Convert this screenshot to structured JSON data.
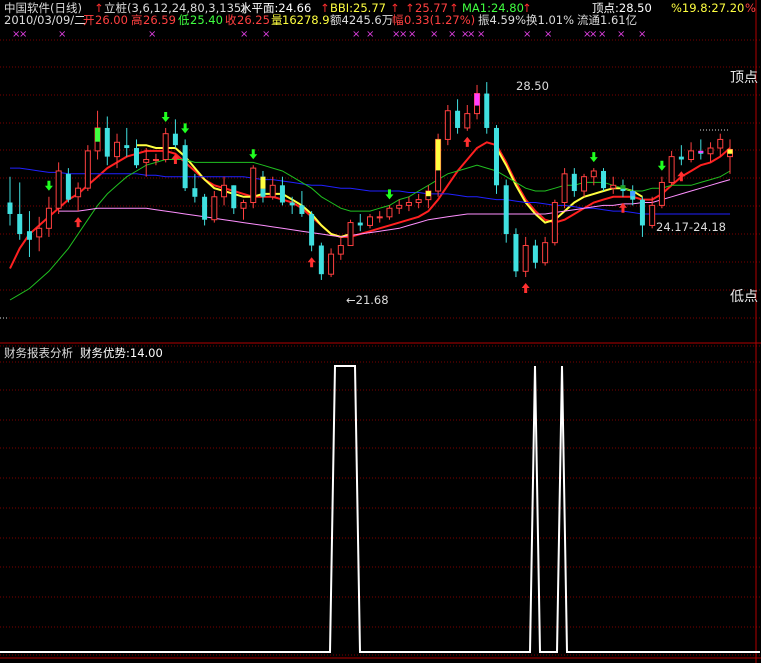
{
  "header": {
    "title": "中国软件(日线)",
    "indicator": "立桩(3,6,12,24,80,3,135)",
    "level": "水平面:24.66",
    "bbi": "BBI:25.77",
    "bbi_value": "25.77",
    "ma1": "MA1:24.80",
    "peak": "顶点:28.50",
    "ratio": "%19.8:27.20",
    "pct": "%"
  },
  "quote": {
    "date": "2010/03/09/二",
    "open_label": "开",
    "open": "26.00",
    "high_label": "高",
    "high": "26.59",
    "low_label": "低",
    "low": "25.40",
    "close_label": "收",
    "close": "26.25",
    "volume_label": "量",
    "volume": "16278.9",
    "amount": "额4245.6万",
    "change_label": "幅",
    "change": "0.33(1.27%)",
    "amplitude": "振4.59%",
    "turnover": "换1.01%",
    "float": "流通1.61亿"
  },
  "annotations": {
    "top_label": "顶点",
    "bottom_label": "低点",
    "high_price": "28.50",
    "low_price": "←21.68",
    "range": "24.17-24.18"
  },
  "lower_panel": {
    "title": "财务报表分析",
    "indicator": "财务优势:14.00"
  },
  "chart_data": {
    "type": "candlestick",
    "panels": [
      {
        "name": "price",
        "ylim": [
          21.0,
          29.3
        ],
        "annotated_values": {
          "high": 28.5,
          "low": 21.68
        },
        "candles": [
          [
            24.4,
            25.3,
            23.6,
            24.0
          ],
          [
            24.0,
            25.1,
            23.1,
            23.3
          ],
          [
            23.4,
            24.1,
            22.5,
            23.1
          ],
          [
            23.2,
            23.9,
            22.7,
            23.5
          ],
          [
            23.5,
            24.6,
            23.2,
            24.2
          ],
          [
            24.2,
            25.8,
            24.0,
            25.5
          ],
          [
            25.4,
            25.6,
            24.4,
            24.5
          ],
          [
            24.6,
            25.1,
            24.1,
            24.9
          ],
          [
            24.9,
            26.4,
            24.8,
            26.2
          ],
          [
            26.2,
            27.6,
            25.9,
            27.0
          ],
          [
            27.0,
            27.4,
            25.7,
            26.0
          ],
          [
            26.0,
            26.8,
            25.6,
            26.5
          ],
          [
            26.4,
            27.0,
            26.0,
            26.3
          ],
          [
            26.3,
            26.6,
            25.6,
            25.7
          ],
          [
            25.8,
            26.3,
            25.3,
            25.9
          ],
          [
            25.9,
            26.1,
            25.7,
            25.9
          ],
          [
            25.9,
            27.0,
            25.8,
            26.8
          ],
          [
            26.8,
            27.3,
            26.3,
            26.4
          ],
          [
            26.4,
            26.6,
            24.8,
            24.9
          ],
          [
            24.9,
            25.4,
            24.4,
            24.6
          ],
          [
            24.6,
            24.7,
            23.6,
            23.8
          ],
          [
            23.8,
            24.8,
            23.7,
            24.6
          ],
          [
            24.6,
            25.3,
            24.3,
            25.0
          ],
          [
            25.0,
            25.0,
            24.0,
            24.2
          ],
          [
            24.2,
            24.5,
            23.8,
            24.4
          ],
          [
            24.4,
            25.7,
            24.2,
            25.6
          ],
          [
            25.3,
            25.5,
            24.4,
            24.6
          ],
          [
            24.6,
            25.3,
            24.5,
            25.0
          ],
          [
            25.0,
            25.3,
            24.3,
            24.4
          ],
          [
            24.4,
            24.6,
            24.0,
            24.3
          ],
          [
            24.3,
            24.8,
            23.9,
            24.0
          ],
          [
            24.0,
            24.1,
            22.7,
            22.9
          ],
          [
            22.9,
            23.0,
            21.7,
            21.9
          ],
          [
            21.9,
            22.8,
            21.8,
            22.6
          ],
          [
            22.6,
            23.2,
            22.4,
            22.9
          ],
          [
            22.9,
            23.8,
            22.9,
            23.7
          ],
          [
            23.7,
            24.0,
            23.4,
            23.6
          ],
          [
            23.6,
            24.0,
            23.5,
            23.9
          ],
          [
            23.9,
            24.1,
            23.7,
            23.9
          ],
          [
            23.9,
            24.3,
            23.8,
            24.2
          ],
          [
            24.2,
            24.5,
            24.0,
            24.3
          ],
          [
            24.3,
            24.6,
            24.1,
            24.4
          ],
          [
            24.4,
            24.7,
            24.2,
            24.5
          ],
          [
            24.5,
            25.0,
            24.2,
            24.8
          ],
          [
            24.8,
            26.8,
            24.6,
            26.6
          ],
          [
            26.6,
            27.8,
            26.4,
            27.6
          ],
          [
            27.6,
            28.0,
            26.8,
            27.0
          ],
          [
            27.0,
            27.8,
            26.9,
            27.5
          ],
          [
            27.5,
            28.5,
            27.3,
            28.2
          ],
          [
            28.2,
            28.6,
            26.8,
            27.0
          ],
          [
            27.0,
            27.1,
            24.7,
            25.0
          ],
          [
            25.0,
            25.2,
            23.0,
            23.3
          ],
          [
            23.3,
            23.5,
            21.8,
            22.0
          ],
          [
            22.0,
            23.2,
            21.8,
            22.9
          ],
          [
            22.9,
            23.1,
            22.1,
            22.3
          ],
          [
            22.3,
            23.2,
            22.2,
            23.0
          ],
          [
            23.0,
            24.5,
            22.9,
            24.4
          ],
          [
            24.4,
            25.6,
            24.2,
            25.4
          ],
          [
            25.4,
            25.6,
            24.6,
            24.8
          ],
          [
            24.8,
            25.4,
            24.6,
            25.3
          ],
          [
            25.3,
            25.6,
            25.0,
            25.5
          ],
          [
            25.5,
            25.6,
            24.8,
            24.9
          ],
          [
            24.9,
            25.3,
            24.7,
            25.0
          ],
          [
            25.0,
            25.2,
            24.6,
            24.8
          ],
          [
            24.8,
            25.0,
            24.3,
            24.5
          ],
          [
            24.5,
            24.6,
            23.2,
            23.6
          ],
          [
            23.6,
            24.6,
            23.5,
            24.3
          ],
          [
            24.3,
            25.3,
            24.2,
            25.1
          ],
          [
            25.1,
            26.2,
            25.0,
            26.0
          ],
          [
            26.0,
            26.4,
            25.7,
            25.9
          ],
          [
            25.9,
            26.5,
            25.8,
            26.2
          ],
          [
            26.2,
            26.6,
            25.9,
            26.1
          ],
          [
            26.1,
            26.5,
            25.8,
            26.3
          ],
          [
            26.3,
            26.8,
            26.0,
            26.6
          ],
          [
            26.0,
            26.6,
            25.4,
            26.25
          ]
        ],
        "series": [
          {
            "name": "BBI",
            "color": "#ff2020",
            "values": [
              22.1,
              22.8,
              23.3,
              23.6,
              23.9,
              24.2,
              24.5,
              24.7,
              25.0,
              25.3,
              25.6,
              25.8,
              26.0,
              26.1,
              26.2,
              26.2,
              26.2,
              26.1,
              25.8,
              25.5,
              25.2,
              25.0,
              24.9,
              24.8,
              24.7,
              24.6,
              24.6,
              24.6,
              24.5,
              24.4,
              24.2,
              23.9,
              23.6,
              23.3,
              23.2,
              23.2,
              23.3,
              23.4,
              23.5,
              23.6,
              23.7,
              23.8,
              23.9,
              24.1,
              24.5,
              25.0,
              25.5,
              25.9,
              26.3,
              26.5,
              26.4,
              25.8,
              25.1,
              24.5,
              24.1,
              23.8,
              23.7,
              23.8,
              24.0,
              24.2,
              24.4,
              24.5,
              24.6,
              24.6,
              24.6,
              24.5,
              24.5,
              24.7,
              25.0,
              25.3,
              25.5,
              25.7,
              25.8,
              26.0,
              26.3
            ]
          },
          {
            "name": "MA1",
            "color": "#ffff40",
            "values": [
              null,
              null,
              null,
              null,
              null,
              null,
              null,
              null,
              null,
              null,
              null,
              null,
              null,
              26.4,
              26.4,
              26.3,
              26.3,
              26.3,
              26.0,
              25.6,
              25.2,
              24.9,
              24.8,
              24.7,
              24.6,
              24.6,
              24.7,
              24.7,
              24.7,
              24.5,
              24.3,
              24.0,
              23.6,
              23.3,
              23.2,
              23.3,
              null,
              null,
              null,
              null,
              null,
              null,
              null,
              null,
              null,
              null,
              null,
              null,
              null,
              null,
              26.3,
              25.7,
              25.0,
              24.4,
              24.0,
              23.7,
              23.8,
              24.1,
              24.4,
              24.6,
              24.7,
              24.8,
              24.9,
              24.9,
              24.8,
              24.6,
              null,
              null,
              null,
              null,
              null,
              null,
              null,
              null,
              null
            ]
          },
          {
            "name": "line3",
            "color": "#2020ff",
            "values": [
              25.6,
              25.6,
              25.55,
              25.5,
              25.45,
              25.45,
              25.4,
              25.4,
              25.4,
              25.4,
              25.4,
              25.4,
              25.4,
              25.4,
              25.35,
              25.35,
              25.3,
              25.3,
              25.3,
              25.3,
              25.3,
              25.3,
              25.3,
              25.3,
              25.3,
              25.25,
              25.2,
              25.2,
              25.15,
              25.1,
              25.05,
              25.0,
              25.0,
              24.95,
              24.9,
              24.9,
              24.85,
              24.8,
              24.8,
              24.8,
              24.8,
              24.75,
              24.75,
              24.7,
              24.7,
              24.7,
              24.65,
              24.6,
              24.6,
              24.55,
              24.5,
              24.5,
              24.45,
              24.4,
              24.4,
              24.35,
              24.3,
              24.3,
              24.25,
              24.2,
              24.2,
              24.15,
              24.1,
              24.1,
              24.05,
              24.0,
              24.0,
              24.0,
              24.0,
              24.0,
              24.0,
              24.0,
              24.0,
              24.0,
              24.0
            ]
          },
          {
            "name": "line4",
            "color": "#20c020",
            "values": [
              21.0,
              21.2,
              21.4,
              21.7,
              22.0,
              22.4,
              22.8,
              23.3,
              23.8,
              24.3,
              24.7,
              25.0,
              25.3,
              25.5,
              25.7,
              25.8,
              25.9,
              25.9,
              25.9,
              25.8,
              25.8,
              25.8,
              25.8,
              25.8,
              25.8,
              25.8,
              25.7,
              25.6,
              25.5,
              25.3,
              25.1,
              24.9,
              24.6,
              24.4,
              24.2,
              24.1,
              24.1,
              24.1,
              24.2,
              24.3,
              24.5,
              24.6,
              24.8,
              25.0,
              25.2,
              25.4,
              25.5,
              25.6,
              25.7,
              25.6,
              25.5,
              25.3,
              25.1,
              24.9,
              24.8,
              24.8,
              24.9,
              25.0,
              25.0,
              25.1,
              25.1,
              25.1,
              25.0,
              24.9,
              24.8,
              24.8,
              24.9,
              24.9,
              25.0,
              25.0,
              25.0,
              25.1,
              25.2,
              25.3,
              25.5
            ]
          },
          {
            "name": "line5",
            "color": "#ff90ff",
            "values": [
              null,
              null,
              null,
              null,
              null,
              24.1,
              24.1,
              24.1,
              24.15,
              24.2,
              24.2,
              24.2,
              24.2,
              24.2,
              24.2,
              24.15,
              24.1,
              24.05,
              24.0,
              23.95,
              23.9,
              23.85,
              23.8,
              23.75,
              23.7,
              23.65,
              23.6,
              23.55,
              23.5,
              23.45,
              23.4,
              23.35,
              23.3,
              23.25,
              23.2,
              23.25,
              23.3,
              23.35,
              23.4,
              23.45,
              23.5,
              23.6,
              23.7,
              23.8,
              23.85,
              23.9,
              23.95,
              24.0,
              24.0,
              24.0,
              24.0,
              24.0,
              24.0,
              24.0,
              24.0,
              24.0,
              24.05,
              24.1,
              24.15,
              24.2,
              24.25,
              24.3,
              24.3,
              24.35,
              24.35,
              24.4,
              24.4,
              24.5,
              24.6,
              24.7,
              24.8,
              24.9,
              25.0,
              25.1,
              25.2
            ]
          }
        ],
        "up_arrows": [
          7,
          17,
          31,
          47,
          53,
          63,
          69
        ],
        "down_arrows": [
          4,
          16,
          18,
          25,
          39,
          60,
          67
        ]
      },
      {
        "name": "财务优势",
        "ylim": [
          0,
          14
        ],
        "series": [
          {
            "name": "财务优势",
            "color": "#ffffff",
            "x": [
              0,
              330,
              335,
              355,
              360,
              530,
              535,
              540,
              545,
              557,
              562,
              567,
              572,
              760
            ],
            "values": [
              0,
              0,
              14,
              14,
              0,
              0,
              14,
              0,
              0,
              0,
              14,
              0,
              0,
              0
            ]
          }
        ]
      }
    ]
  }
}
